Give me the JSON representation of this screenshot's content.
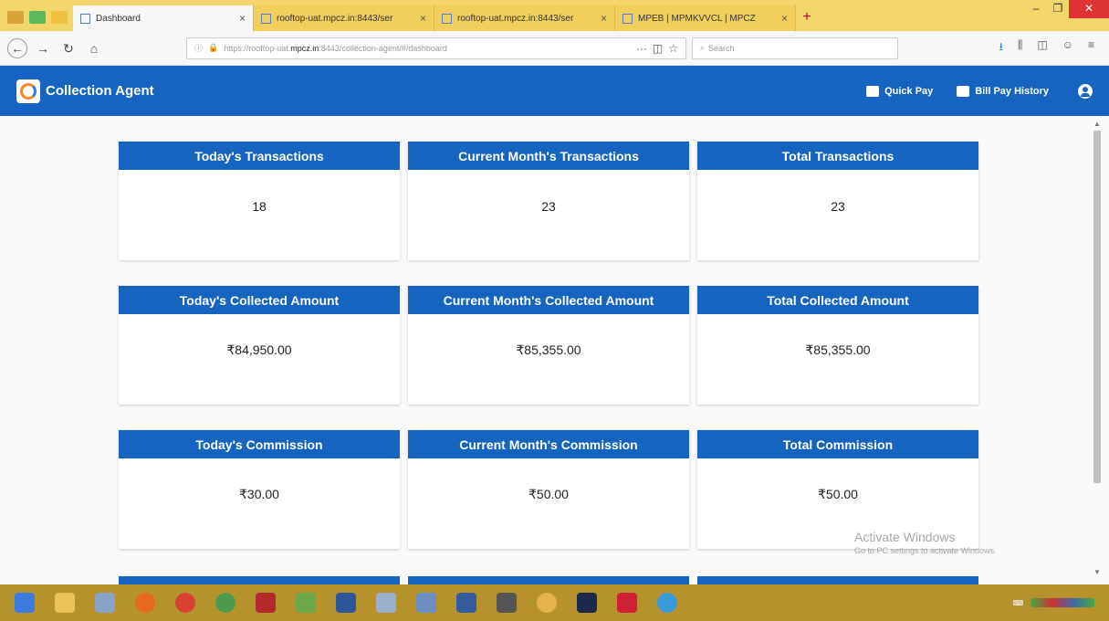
{
  "browser": {
    "tabs": [
      {
        "title": "Dashboard",
        "active": true
      },
      {
        "title": "rooftop-uat.mpcz.in:8443/ser",
        "active": false
      },
      {
        "title": "rooftop-uat.mpcz.in:8443/ser",
        "active": false
      },
      {
        "title": "MPEB | MPMKVVCL | MPCZ",
        "active": false
      }
    ],
    "url_prefix": "https://rooftop-uat.",
    "url_domain": "mpcz.in",
    "url_suffix": ":8443/collection-agent/#/dashboard",
    "search_placeholder": "Search"
  },
  "app": {
    "title": "Collection Agent",
    "quick_pay_label": "Quick Pay",
    "bill_pay_history_label": "Bill Pay History"
  },
  "cards": [
    {
      "title": "Today's Transactions",
      "value": "18"
    },
    {
      "title": "Current Month's Transactions",
      "value": "23"
    },
    {
      "title": "Total Transactions",
      "value": "23"
    },
    {
      "title": "Today's Collected Amount",
      "value": "₹84,950.00"
    },
    {
      "title": "Current Month's Collected Amount",
      "value": "₹85,355.00"
    },
    {
      "title": "Total Collected Amount",
      "value": "₹85,355.00"
    },
    {
      "title": "Today's Commission",
      "value": "₹30.00"
    },
    {
      "title": "Current Month's Commission",
      "value": "₹50.00"
    },
    {
      "title": "Total Commission",
      "value": "₹50.00"
    }
  ],
  "watermark": {
    "line1": "Activate Windows",
    "line2": "Go to PC settings to activate Windows."
  },
  "colors": {
    "brand": "#1565c0",
    "tabstrip": "#f2d56b",
    "taskbar": "#b5922c"
  }
}
